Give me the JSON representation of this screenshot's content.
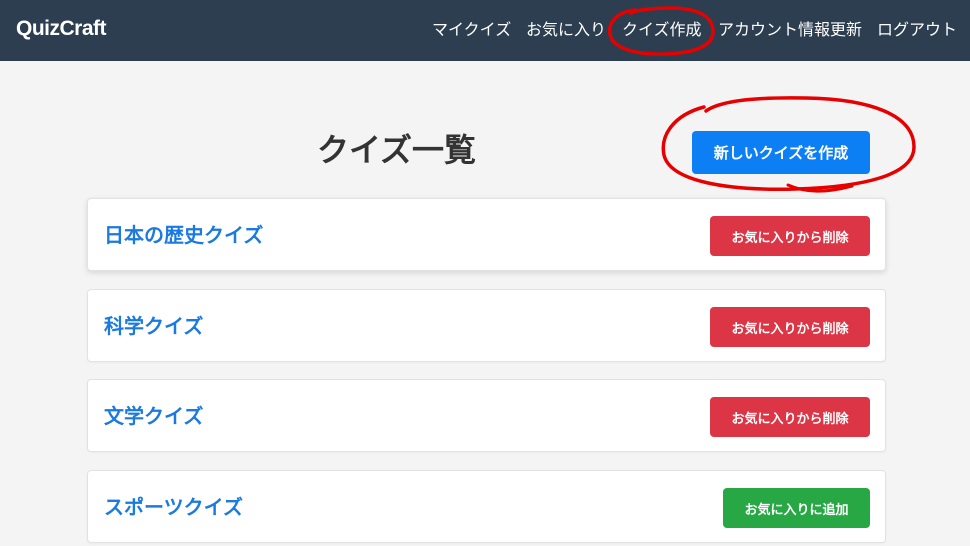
{
  "navbar": {
    "brand": "QuizCraft",
    "links": [
      "マイクイズ",
      "お気に入り",
      "クイズ作成",
      "アカウント情報更新",
      "ログアウト"
    ]
  },
  "main": {
    "title": "クイズ一覧",
    "create_button_label": "新しいクイズを作成",
    "quizzes": [
      {
        "title": "日本の歴史クイズ",
        "action_label": "お気に入りから削除",
        "action": "remove"
      },
      {
        "title": "科学クイズ",
        "action_label": "お気に入りから削除",
        "action": "remove"
      },
      {
        "title": "文学クイズ",
        "action_label": "お気に入りから削除",
        "action": "remove"
      },
      {
        "title": "スポーツクイズ",
        "action_label": "お気に入りに追加",
        "action": "add"
      }
    ]
  },
  "colors": {
    "navbar_bg": "#2c3e50",
    "primary": "#0d7ff5",
    "danger": "#dc3545",
    "success": "#28a745",
    "link": "#1a7ae0",
    "annotation": "#e60000"
  }
}
